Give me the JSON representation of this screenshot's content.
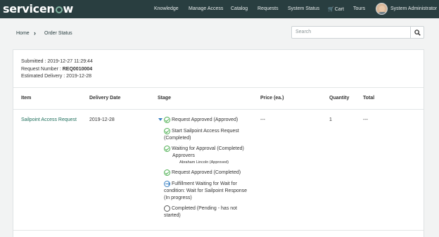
{
  "header": {
    "logo": "servicenow",
    "nav": [
      "Knowledge",
      "Manage Access",
      "Catalog",
      "Requests",
      "System Status",
      "Cart",
      "Tours"
    ],
    "user_name": "System Administrator"
  },
  "breadcrumb": {
    "home": "Home",
    "current": "Order Status"
  },
  "search": {
    "placeholder": "Search"
  },
  "order": {
    "submitted": "Submitted : 2019-12-27 11:29:44",
    "request_number_label": "Request Number : ",
    "request_number": "REQ0010004",
    "estimated_delivery": "Estimated Delivery : 2019-12-28"
  },
  "table": {
    "headers": [
      "Item",
      "Delivery Date",
      "Stage",
      "Price (ea.)",
      "Quantity",
      "Total"
    ],
    "row": {
      "item": "Sailpoint Access Request",
      "delivery_date": "2019-12-28",
      "price": "---",
      "quantity": "1",
      "total": "---"
    }
  },
  "stage": {
    "summary": "Request Approved (Approved)",
    "steps": [
      {
        "lines": [
          "Start Sailpoint Access Request",
          "(Completed)"
        ],
        "status": "done"
      },
      {
        "lines": [
          "Waiting for Approval (Completed)"
        ],
        "status": "done"
      },
      {
        "lines": [
          "Request Approved (Completed)"
        ],
        "status": "done"
      },
      {
        "lines": [
          "Fulfillment Waiting for Wait for",
          "condition: Wait for Sailpoint Response",
          "(In progress)"
        ],
        "status": "in-progress"
      },
      {
        "lines": [
          "Completed (Pending - has not",
          "started)"
        ],
        "status": "pending"
      }
    ],
    "approvers_label": "Approvers",
    "approver": "Abraham Lincoln (Approved)"
  },
  "colors": {
    "header_bg": "#293e40",
    "link": "#1f6f5c",
    "done": "#4caf50",
    "in_progress": "#3b82c4"
  },
  "icons": [
    "search-icon",
    "cart-icon",
    "chevron-right-icon",
    "check-circle-icon",
    "arrow-circle-icon",
    "empty-circle-icon",
    "caret-down-icon"
  ]
}
